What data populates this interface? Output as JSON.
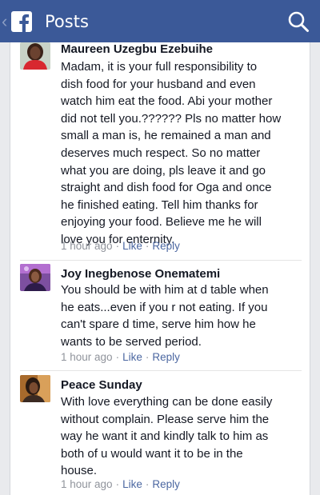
{
  "header": {
    "title": "Posts",
    "back_glyph": "‹",
    "logo_icon": "facebook-logo-icon",
    "search_icon": "search-icon",
    "bar_color": "#3b5998"
  },
  "comments": [
    {
      "author": "Maureen Uzegbu Ezebuihe",
      "lines": [
        "Madam,  it is your full responsibility to",
        "dish food for your husband and even",
        "watch him eat the food. Abi your mother",
        "did not tell you.?????? Pls no matter how",
        "small a man is, he remained a man and",
        "deserves much respect. So no matter",
        "what you are doing,  pls leave it and go",
        "straight and dish food for Oga and once",
        "he finished eating.  Tell him thanks for",
        "enjoying your food. Believe me he will",
        "love you for enternity."
      ],
      "time": "1 hour ago",
      "like": "Like",
      "reply": "Reply"
    },
    {
      "author": "Joy Inegbenose Onematemi",
      "lines": [
        "You should be with him at d table when",
        "he eats...even if you r not eating. If you",
        "can't spare d time, serve him how he",
        "wants to be served period."
      ],
      "time": "1 hour ago",
      "like": "Like",
      "reply": "Reply"
    },
    {
      "author": "Peace Sunday",
      "lines": [
        "With love everything can be done easily",
        "without complain. Please serve him the",
        "way he want it and kindly talk to him as",
        "both of u would want it to be in the",
        "house."
      ],
      "time": "1 hour ago",
      "like": "Like",
      "reply": "Reply"
    }
  ],
  "separator": "·"
}
